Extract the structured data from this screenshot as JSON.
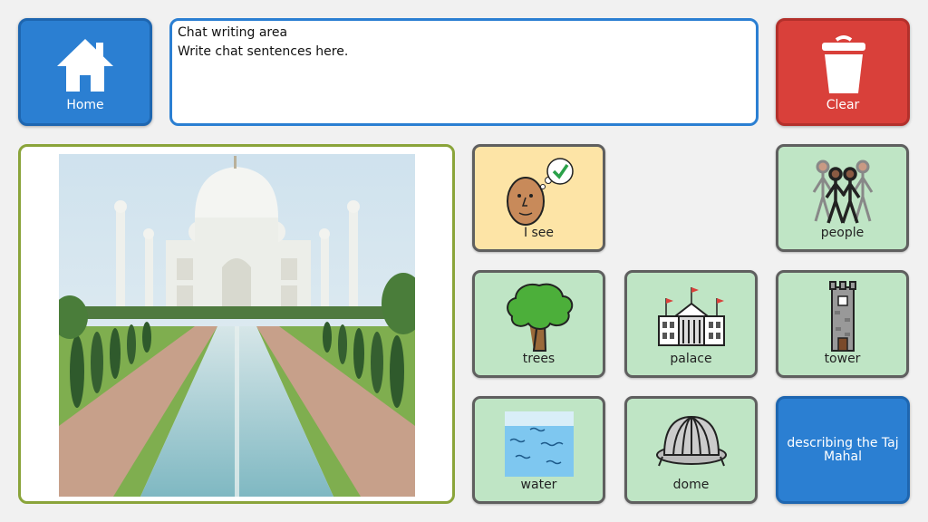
{
  "home": {
    "label": "Home",
    "icon": "home-icon"
  },
  "chat": {
    "title": "Chat writing area",
    "placeholder": "Write chat sentences here."
  },
  "clear": {
    "label": "Clear",
    "icon": "trash-icon"
  },
  "photo": {
    "subject": "Taj Mahal photo"
  },
  "tiles": {
    "i_see": {
      "label": "I see",
      "icon": "face-thinking-check-icon",
      "color": "#fde4a6"
    },
    "people": {
      "label": "people",
      "icon": "people-icon",
      "color": "#bfe5c5"
    },
    "trees": {
      "label": "trees",
      "icon": "tree-icon",
      "color": "#bfe5c5"
    },
    "palace": {
      "label": "palace",
      "icon": "palace-icon",
      "color": "#bfe5c5"
    },
    "tower": {
      "label": "tower",
      "icon": "tower-icon",
      "color": "#bfe5c5"
    },
    "water": {
      "label": "water",
      "icon": "water-icon",
      "color": "#bfe5c5"
    },
    "dome": {
      "label": "dome",
      "icon": "dome-icon",
      "color": "#bfe5c5"
    }
  },
  "describe": {
    "label": "describing the Taj Mahal"
  },
  "colors": {
    "blue": "#2b7fd2",
    "red": "#d9403a",
    "green_tile": "#bfe5c5",
    "yellow_tile": "#fde4a6",
    "photo_border": "#8aa43a"
  }
}
